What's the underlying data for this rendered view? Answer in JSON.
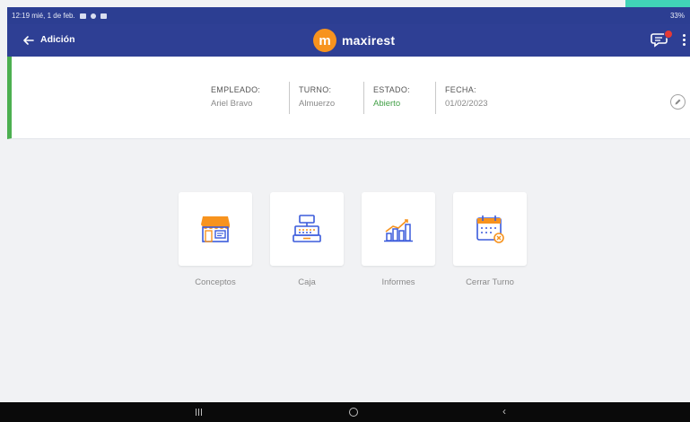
{
  "status_bar": {
    "time_date": "12:19 mié, 1 de feb.",
    "battery": "33%"
  },
  "app_bar": {
    "title": "Adición",
    "brand_letter": "m",
    "brand_name": "maxirest"
  },
  "shift_info": {
    "employee": {
      "label": "EMPLEADO:",
      "value": "Ariel Bravo"
    },
    "shift": {
      "label": "TURNO:",
      "value": "Almuerzo"
    },
    "status": {
      "label": "ESTADO:",
      "value": "Abierto",
      "color": "#43a047"
    },
    "date": {
      "label": "FECHA:",
      "value": "01/02/2023"
    }
  },
  "menu_tiles": [
    {
      "label": "Conceptos",
      "icon": "storefront-icon"
    },
    {
      "label": "Caja",
      "icon": "cash-register-icon"
    },
    {
      "label": "Informes",
      "icon": "bar-chart-icon"
    },
    {
      "label": "Cerrar Turno",
      "icon": "calendar-close-icon"
    }
  ],
  "colors": {
    "primary": "#2e3f94",
    "accent_orange": "#f7931e",
    "status_green": "#4caf50",
    "icon_blue": "#3b5bdb"
  }
}
